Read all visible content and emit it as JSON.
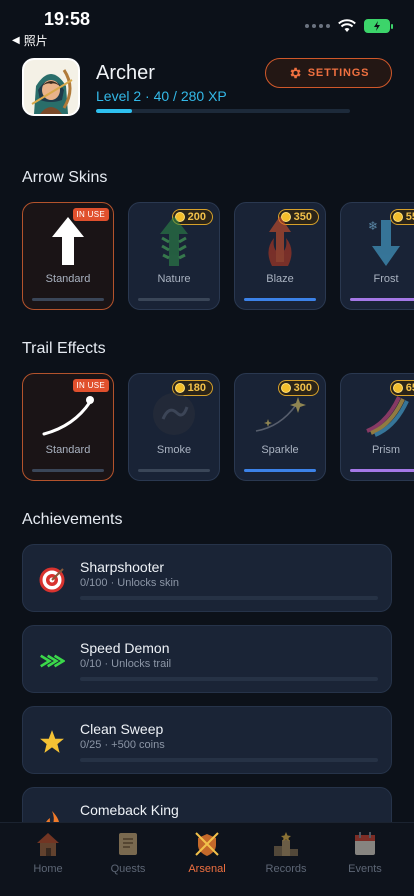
{
  "status_bar": {
    "time": "19:58",
    "back_label": "照片"
  },
  "profile": {
    "name": "Archer",
    "level_text": "Level 2 · 40 / 280 XP",
    "xp_current": 40,
    "xp_max": 280,
    "settings_label": "SETTINGS"
  },
  "arrow_skins": {
    "title": "Arrow Skins",
    "items": [
      {
        "name": "Standard",
        "badge": "IN USE"
      },
      {
        "name": "Nature",
        "price": "200"
      },
      {
        "name": "Blaze",
        "price": "350"
      },
      {
        "name": "Frost",
        "price": "55"
      }
    ]
  },
  "trail_effects": {
    "title": "Trail Effects",
    "items": [
      {
        "name": "Standard",
        "badge": "IN USE"
      },
      {
        "name": "Smoke",
        "price": "180"
      },
      {
        "name": "Sparkle",
        "price": "300"
      },
      {
        "name": "Prism",
        "price": "65"
      }
    ]
  },
  "achievements": {
    "title": "Achievements",
    "items": [
      {
        "title": "Sharpshooter",
        "subtitle": "0/100 · Unlocks skin",
        "icon": "target-icon"
      },
      {
        "title": "Speed Demon",
        "subtitle": "0/10 · Unlocks trail",
        "icon": "speed-arrows-icon"
      },
      {
        "title": "Clean Sweep",
        "subtitle": "0/25 · +500 coins",
        "icon": "star-icon"
      },
      {
        "title": "Comeback King",
        "subtitle": "",
        "icon": "flame-icon"
      }
    ]
  },
  "tabs": [
    {
      "label": "Home",
      "icon": "home-icon"
    },
    {
      "label": "Quests",
      "icon": "scroll-icon"
    },
    {
      "label": "Arsenal",
      "icon": "crossed-arrows-shield-icon",
      "active": true
    },
    {
      "label": "Records",
      "icon": "podium-icon"
    },
    {
      "label": "Events",
      "icon": "calendar-icon"
    }
  ],
  "colors": {
    "background": "#0c1119",
    "accent_orange": "#ef7040",
    "accent_blue": "#2ec0ef",
    "coin_gold": "#f2bd2c"
  }
}
